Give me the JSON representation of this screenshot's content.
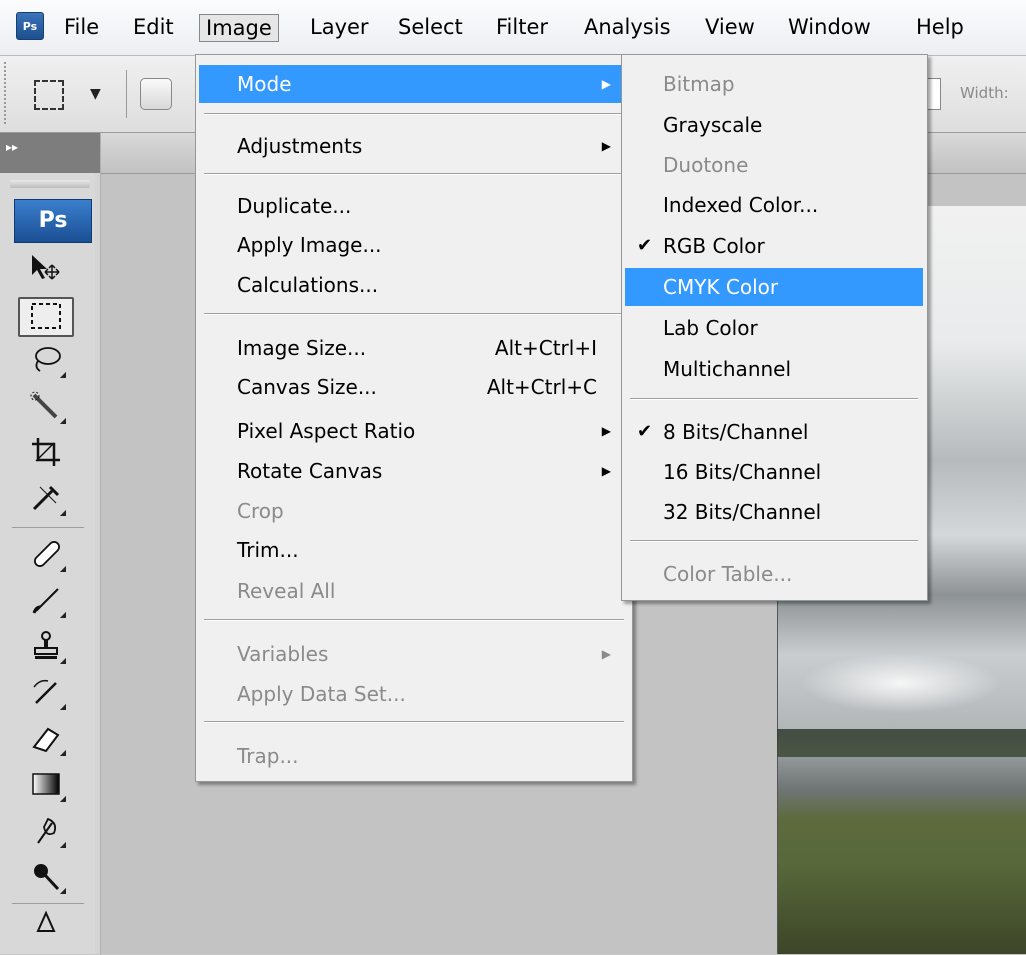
{
  "menubar": {
    "logo": "Ps",
    "items": [
      "File",
      "Edit",
      "Image",
      "Layer",
      "Select",
      "Filter",
      "Analysis",
      "View",
      "Window",
      "Help"
    ]
  },
  "options_bar": {
    "width_label": "Width:"
  },
  "tools": {
    "expand": "▸▸",
    "ps_badge": "Ps"
  },
  "image_menu": {
    "items": [
      {
        "label": "Mode",
        "submenu": true,
        "highlighted": true
      },
      {
        "label": "Adjustments",
        "submenu": true
      },
      {
        "label": "Duplicate..."
      },
      {
        "label": "Apply Image..."
      },
      {
        "label": "Calculations..."
      },
      {
        "label": "Image Size...",
        "shortcut": "Alt+Ctrl+I"
      },
      {
        "label": "Canvas Size...",
        "shortcut": "Alt+Ctrl+C"
      },
      {
        "label": "Pixel Aspect Ratio",
        "submenu": true
      },
      {
        "label": "Rotate Canvas",
        "submenu": true
      },
      {
        "label": "Crop",
        "disabled": true
      },
      {
        "label": "Trim..."
      },
      {
        "label": "Reveal All",
        "disabled": true
      },
      {
        "label": "Variables",
        "submenu": true,
        "disabled": true
      },
      {
        "label": "Apply Data Set...",
        "disabled": true
      },
      {
        "label": "Trap...",
        "disabled": true
      }
    ]
  },
  "mode_submenu": {
    "items": [
      {
        "label": "Bitmap",
        "disabled": true
      },
      {
        "label": "Grayscale"
      },
      {
        "label": "Duotone",
        "disabled": true
      },
      {
        "label": "Indexed Color..."
      },
      {
        "label": "RGB Color",
        "checked": true
      },
      {
        "label": "CMYK Color",
        "highlighted": true
      },
      {
        "label": "Lab Color"
      },
      {
        "label": "Multichannel"
      },
      {
        "label": "8 Bits/Channel",
        "checked": true
      },
      {
        "label": "16 Bits/Channel"
      },
      {
        "label": "32 Bits/Channel"
      },
      {
        "label": "Color Table...",
        "disabled": true
      }
    ]
  },
  "glyphs": {
    "submenu_arrow": "▶",
    "check": "✔",
    "dropdown": "▼"
  },
  "colors": {
    "highlight": "#3399ff",
    "menu_bg": "#f0f0f0",
    "disabled_text": "#8a8a8a"
  }
}
